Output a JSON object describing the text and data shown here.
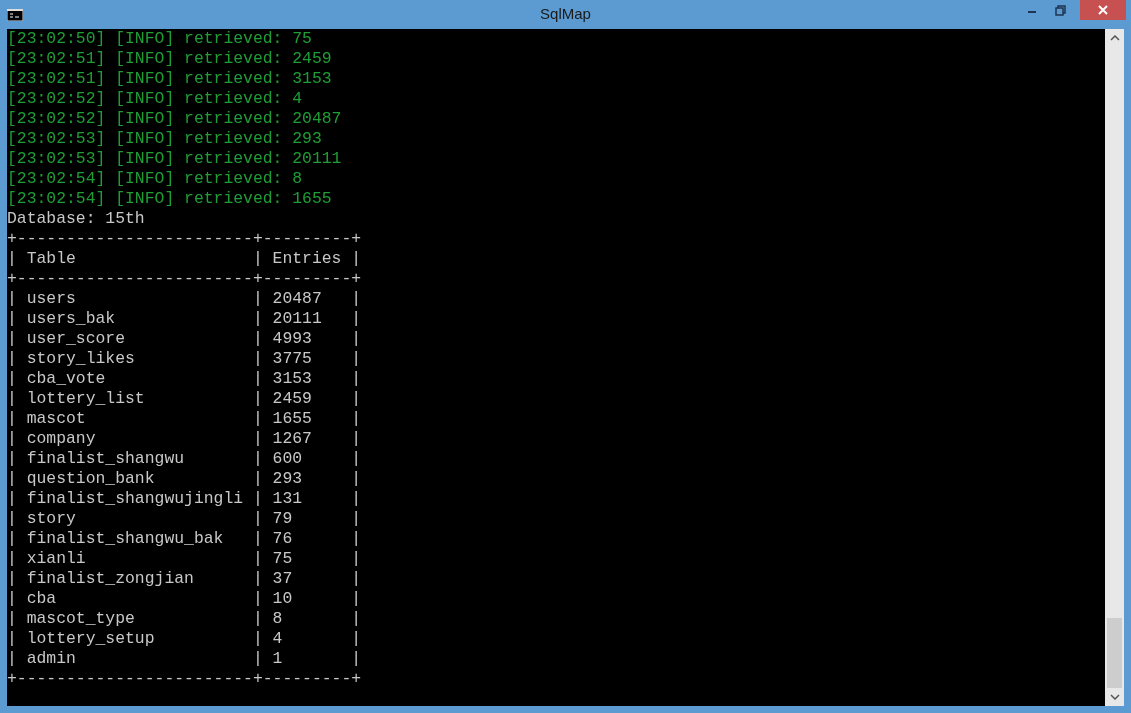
{
  "window": {
    "title": "SqlMap"
  },
  "lines": [
    {
      "kind": "log",
      "text": "[23:02:50] [INFO] retrieved: 75"
    },
    {
      "kind": "log",
      "text": "[23:02:51] [INFO] retrieved: 2459"
    },
    {
      "kind": "log",
      "text": "[23:02:51] [INFO] retrieved: 3153"
    },
    {
      "kind": "log",
      "text": "[23:02:52] [INFO] retrieved: 4"
    },
    {
      "kind": "log",
      "text": "[23:02:52] [INFO] retrieved: 20487"
    },
    {
      "kind": "log",
      "text": "[23:02:53] [INFO] retrieved: 293"
    },
    {
      "kind": "log",
      "text": "[23:02:53] [INFO] retrieved: 20111"
    },
    {
      "kind": "log",
      "text": "[23:02:54] [INFO] retrieved: 8"
    },
    {
      "kind": "log",
      "text": "[23:02:54] [INFO] retrieved: 1655"
    },
    {
      "kind": "output",
      "text": "Database: 15th"
    },
    {
      "kind": "output",
      "text": "+------------------------+---------+"
    },
    {
      "kind": "output",
      "text": "| Table                  | Entries |"
    },
    {
      "kind": "output",
      "text": "+------------------------+---------+"
    },
    {
      "kind": "output",
      "text": "| users                  | 20487   |"
    },
    {
      "kind": "output",
      "text": "| users_bak              | 20111   |"
    },
    {
      "kind": "output",
      "text": "| user_score             | 4993    |"
    },
    {
      "kind": "output",
      "text": "| story_likes            | 3775    |"
    },
    {
      "kind": "output",
      "text": "| cba_vote               | 3153    |"
    },
    {
      "kind": "output",
      "text": "| lottery_list           | 2459    |"
    },
    {
      "kind": "output",
      "text": "| mascot                 | 1655    |"
    },
    {
      "kind": "output",
      "text": "| company                | 1267    |"
    },
    {
      "kind": "output",
      "text": "| finalist_shangwu       | 600     |"
    },
    {
      "kind": "output",
      "text": "| question_bank          | 293     |"
    },
    {
      "kind": "output",
      "text": "| finalist_shangwujingli | 131     |"
    },
    {
      "kind": "output",
      "text": "| story                  | 79      |"
    },
    {
      "kind": "output",
      "text": "| finalist_shangwu_bak   | 76      |"
    },
    {
      "kind": "output",
      "text": "| xianli                 | 75      |"
    },
    {
      "kind": "output",
      "text": "| finalist_zongjian      | 37      |"
    },
    {
      "kind": "output",
      "text": "| cba                    | 10      |"
    },
    {
      "kind": "output",
      "text": "| mascot_type            | 8       |"
    },
    {
      "kind": "output",
      "text": "| lottery_setup          | 4       |"
    },
    {
      "kind": "output",
      "text": "| admin                  | 1       |"
    },
    {
      "kind": "output",
      "text": "+------------------------+---------+"
    }
  ]
}
